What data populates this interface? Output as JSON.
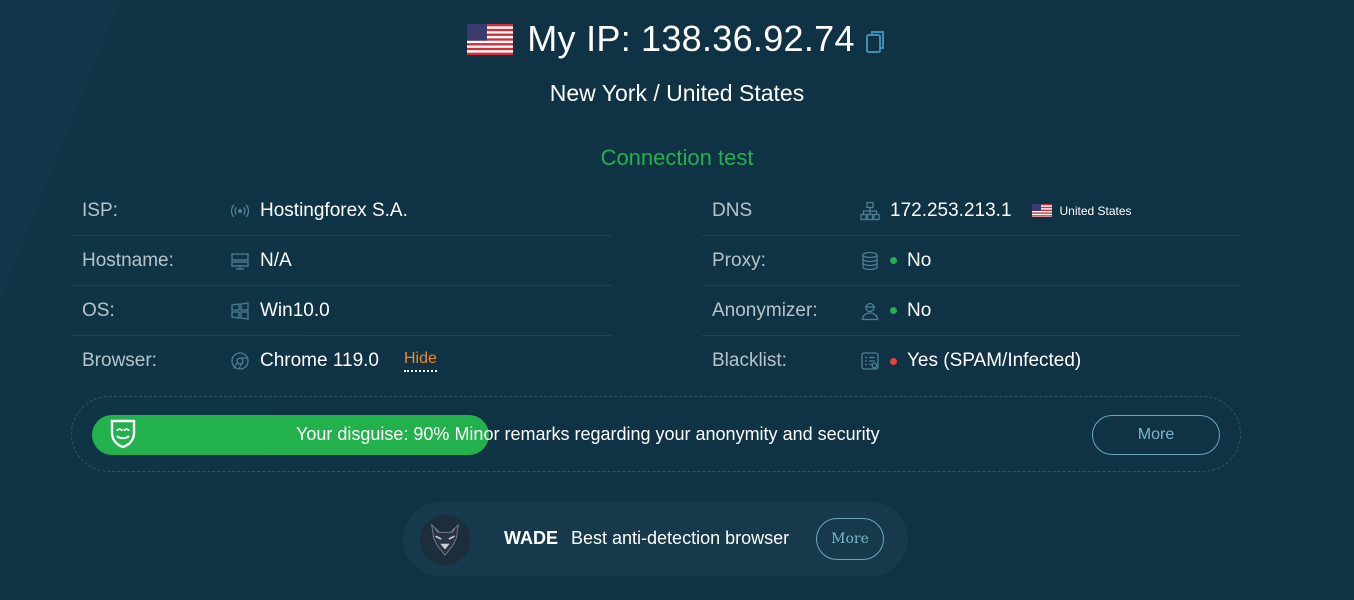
{
  "header": {
    "ip_label": "My IP:",
    "ip_value": "138.36.92.74",
    "location": "New York / United States",
    "flag_icon": "us-flag-icon",
    "copy_icon": "copy-icon"
  },
  "connection_test": {
    "title": "Connection test",
    "left": [
      {
        "key": "ISP:",
        "icon": "broadcast-icon",
        "value": "Hostingforex S.A."
      },
      {
        "key": "Hostname:",
        "icon": "server-icon",
        "value": "N/A"
      },
      {
        "key": "OS:",
        "icon": "windows-icon",
        "value": "Win10.0"
      },
      {
        "key": "Browser:",
        "icon": "chrome-icon",
        "value": "Chrome 119.0",
        "link": "Hide"
      }
    ],
    "right": [
      {
        "key": "DNS",
        "icon": "network-icon",
        "value": "172.253.213.1",
        "country": "United States"
      },
      {
        "key": "Proxy:",
        "icon": "database-icon",
        "value": "No",
        "status": "green"
      },
      {
        "key": "Anonymizer:",
        "icon": "user-icon",
        "value": "No",
        "status": "green"
      },
      {
        "key": "Blacklist:",
        "icon": "list-icon",
        "value": "Yes (SPAM/Infected)",
        "status": "red"
      }
    ]
  },
  "disguise": {
    "text": "Your disguise: 90% Minor remarks regarding your anonymity and security",
    "percent": 90,
    "more_label": "More",
    "icon": "mask-icon"
  },
  "promo": {
    "brand": "WADE",
    "text": "Best anti-detection browser",
    "more_label": "More",
    "icon": "wolf-logo-icon"
  },
  "colors": {
    "background": "#0f3244",
    "accent_green": "#22b14c",
    "link_orange": "#f08a24",
    "status_red": "#e04a3c"
  }
}
